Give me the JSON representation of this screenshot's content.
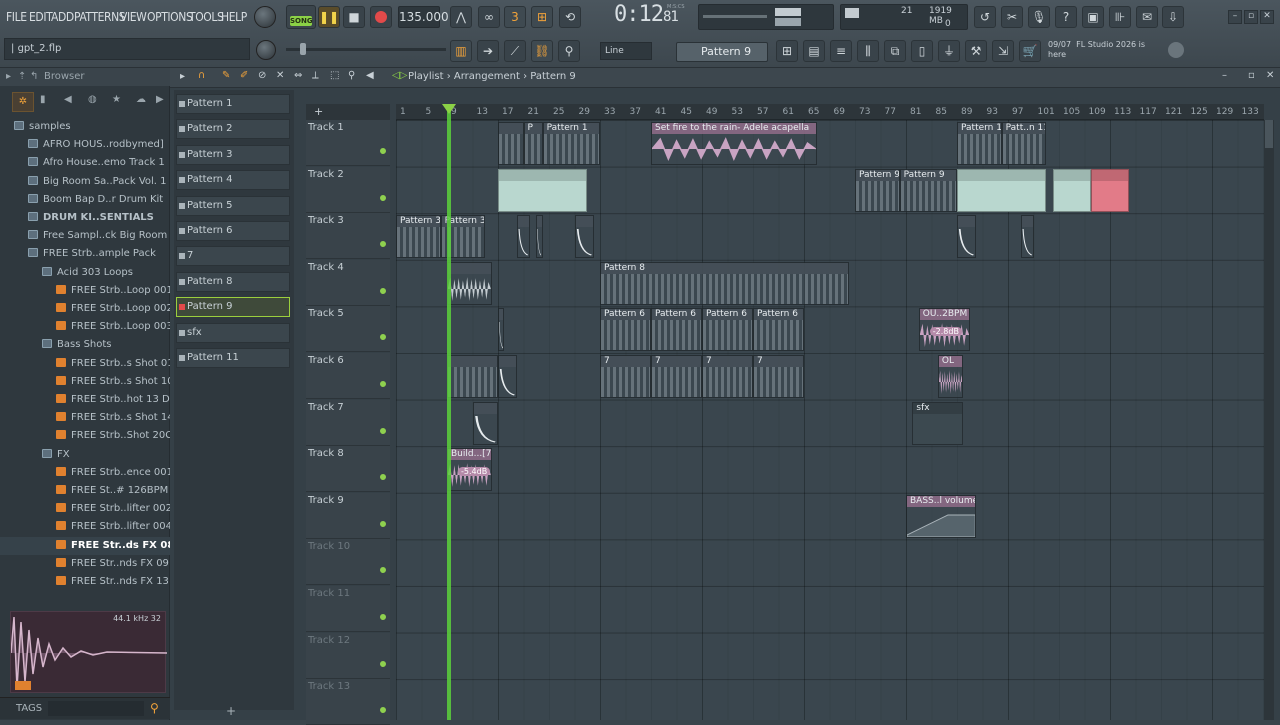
{
  "menu": [
    "FILE",
    "EDIT",
    "ADD",
    "PATTERNS",
    "VIEW",
    "OPTIONS",
    "TOOLS",
    "HELP"
  ],
  "transport": {
    "mode": "SONG",
    "tempo": "135.000",
    "time": "0:12",
    "time_frac": "81",
    "time_unit": "M:S:CS",
    "cpu_voices": "21",
    "memory": "1919 MB",
    "cpu_zero": "0"
  },
  "snap": "Line",
  "pattern_selector": "Pattern 9",
  "news": {
    "date": "09/07",
    "text": "FL Studio 2026 is here"
  },
  "project_file": "gpt_2.flp",
  "browser": {
    "title": "Browser",
    "items": [
      {
        "type": "folder",
        "indent": 0,
        "label": "samples"
      },
      {
        "type": "folder",
        "indent": 1,
        "label": "AFRO HOUS..rodbymed]"
      },
      {
        "type": "folder",
        "indent": 1,
        "label": "Afro House..emo Track 1"
      },
      {
        "type": "folder",
        "indent": 1,
        "label": "Big Room Sa..Pack Vol. 1"
      },
      {
        "type": "folder",
        "indent": 1,
        "label": "Boom Bap D..r Drum Kit"
      },
      {
        "type": "folder",
        "indent": 1,
        "label": "DRUM KI..SENTIALS"
      },
      {
        "type": "folder",
        "indent": 1,
        "label": "Free Sampl..ck Big Room"
      },
      {
        "type": "folder",
        "indent": 1,
        "label": "FREE Strb..ample Pack"
      },
      {
        "type": "folder",
        "indent": 2,
        "label": "Acid 303 Loops"
      },
      {
        "type": "file",
        "indent": 3,
        "label": "FREE Strb..Loop 001"
      },
      {
        "type": "file",
        "indent": 3,
        "label": "FREE Strb..Loop 002"
      },
      {
        "type": "file",
        "indent": 3,
        "label": "FREE Strb..Loop 003"
      },
      {
        "type": "folder",
        "indent": 2,
        "label": "Bass Shots"
      },
      {
        "type": "file",
        "indent": 3,
        "label": "FREE Strb..s Shot 01"
      },
      {
        "type": "file",
        "indent": 3,
        "label": "FREE Strb..s Shot 10"
      },
      {
        "type": "file",
        "indent": 3,
        "label": "FREE Strb..hot 13 D"
      },
      {
        "type": "file",
        "indent": 3,
        "label": "FREE Strb..s Shot 14"
      },
      {
        "type": "file",
        "indent": 3,
        "label": "FREE Strb..Shot 20C"
      },
      {
        "type": "folder",
        "indent": 2,
        "label": "FX"
      },
      {
        "type": "file",
        "indent": 3,
        "label": "FREE Strb..ence 001"
      },
      {
        "type": "file",
        "indent": 3,
        "label": "FREE St..# 126BPM"
      },
      {
        "type": "file",
        "indent": 3,
        "label": "FREE Strb..lifter 002"
      },
      {
        "type": "file",
        "indent": 3,
        "label": "FREE Strb..lifter 004"
      },
      {
        "type": "file",
        "indent": 3,
        "label": "FREE Str..ds FX 08",
        "selected": true
      },
      {
        "type": "file",
        "indent": 3,
        "label": "FREE Str..nds FX 09"
      },
      {
        "type": "file",
        "indent": 3,
        "label": "FREE Str..nds FX 13"
      }
    ],
    "sample_info": "44.1 kHz 32",
    "tags_label": "TAGS"
  },
  "playlist": {
    "breadcrumb": [
      "Playlist",
      "Arrangement",
      "Pattern 9"
    ],
    "patterns": [
      "Pattern 1",
      "Pattern 2",
      "Pattern 3",
      "Pattern 4",
      "Pattern 5",
      "Pattern 6",
      "7",
      "Pattern 8",
      "Pattern 9",
      "sfx",
      "Pattern 11"
    ],
    "selected_pattern": "Pattern 9",
    "tracks": [
      "Track 1",
      "Track 2",
      "Track 3",
      "Track 4",
      "Track 5",
      "Track 6",
      "Track 7",
      "Track 8",
      "Track 9",
      "Track 10",
      "Track 11",
      "Track 12",
      "Track 13"
    ],
    "ruler": [
      "1",
      "5",
      "9",
      "13",
      "17",
      "21",
      "25",
      "29",
      "33",
      "37",
      "41",
      "45",
      "49",
      "53",
      "57",
      "61",
      "65",
      "69",
      "73",
      "77",
      "81",
      "85",
      "89",
      "93",
      "97",
      "101",
      "105",
      "109",
      "113",
      "117",
      "121",
      "125",
      "129",
      "133"
    ],
    "clips": [
      {
        "track": 1,
        "start": 17,
        "len": 4,
        "label": "",
        "kind": "notes"
      },
      {
        "track": 1,
        "start": 21,
        "len": 3,
        "label": "P",
        "kind": "notes"
      },
      {
        "track": 1,
        "start": 24,
        "len": 9,
        "label": "Pattern 1",
        "kind": "notes"
      },
      {
        "track": 1,
        "start": 41,
        "len": 26,
        "label": "Set fire to the rain- Adele acapella",
        "kind": "audio",
        "color": "#c8a3c2"
      },
      {
        "track": 1,
        "start": 89,
        "len": 7,
        "label": "Pattern 11",
        "kind": "notes"
      },
      {
        "track": 1,
        "start": 96,
        "len": 7,
        "label": "Patt..n 11",
        "kind": "notes"
      },
      {
        "track": 2,
        "start": 17,
        "len": 14,
        "label": "",
        "kind": "pattern",
        "color": "#b9d7cf"
      },
      {
        "track": 2,
        "start": 73,
        "len": 7,
        "label": "Pattern 9",
        "kind": "notes"
      },
      {
        "track": 2,
        "start": 80,
        "len": 9,
        "label": "Pattern 9",
        "kind": "notes"
      },
      {
        "track": 2,
        "start": 89,
        "len": 14,
        "label": "",
        "kind": "pattern",
        "color": "#b9d7cf"
      },
      {
        "track": 2,
        "start": 104,
        "len": 6,
        "label": "",
        "kind": "pattern",
        "color": "#b9d7cf"
      },
      {
        "track": 2,
        "start": 110,
        "len": 6,
        "label": "",
        "kind": "pattern",
        "color": "#e27b88"
      },
      {
        "track": 3,
        "start": 1,
        "len": 7,
        "label": "Pattern 3",
        "kind": "notes"
      },
      {
        "track": 3,
        "start": 8,
        "len": 7,
        "label": "Pattern 3",
        "kind": "notes"
      },
      {
        "track": 3,
        "start": 20,
        "len": 2,
        "label": "",
        "kind": "shot"
      },
      {
        "track": 3,
        "start": 23,
        "len": 1,
        "label": "",
        "kind": "shot"
      },
      {
        "track": 3,
        "start": 29,
        "len": 3,
        "label": "",
        "kind": "shot"
      },
      {
        "track": 3,
        "start": 89,
        "len": 3,
        "label": "",
        "kind": "shot"
      },
      {
        "track": 3,
        "start": 99,
        "len": 2,
        "label": "",
        "kind": "shot"
      },
      {
        "track": 4,
        "start": 9,
        "len": 7,
        "label": "",
        "kind": "audio",
        "color": "#c3cbd0"
      },
      {
        "track": 4,
        "start": 33,
        "len": 39,
        "label": "Pattern 8",
        "kind": "notes"
      },
      {
        "track": 5,
        "start": 17,
        "len": 1,
        "label": "",
        "kind": "shot"
      },
      {
        "track": 5,
        "start": 33,
        "len": 8,
        "label": "Pattern 6",
        "kind": "notes"
      },
      {
        "track": 5,
        "start": 41,
        "len": 8,
        "label": "Pattern 6",
        "kind": "notes"
      },
      {
        "track": 5,
        "start": 49,
        "len": 8,
        "label": "Pattern 6",
        "kind": "notes"
      },
      {
        "track": 5,
        "start": 57,
        "len": 8,
        "label": "Pattern 6",
        "kind": "notes"
      },
      {
        "track": 5,
        "start": 83,
        "len": 8,
        "label": "OU..2BPM",
        "kind": "audio",
        "color": "#c8a3c2",
        "badge": "-2.8dB"
      },
      {
        "track": 6,
        "start": 9,
        "len": 8,
        "label": "",
        "kind": "notes"
      },
      {
        "track": 6,
        "start": 17,
        "len": 3,
        "label": "",
        "kind": "shot"
      },
      {
        "track": 6,
        "start": 33,
        "len": 8,
        "label": "7",
        "kind": "notes"
      },
      {
        "track": 6,
        "start": 41,
        "len": 8,
        "label": "7",
        "kind": "notes"
      },
      {
        "track": 6,
        "start": 49,
        "len": 8,
        "label": "7",
        "kind": "notes"
      },
      {
        "track": 6,
        "start": 57,
        "len": 8,
        "label": "7",
        "kind": "notes"
      },
      {
        "track": 6,
        "start": 86,
        "len": 4,
        "label": "OL",
        "kind": "audio",
        "color": "#c8a3c2"
      },
      {
        "track": 7,
        "start": 13,
        "len": 4,
        "label": "",
        "kind": "shot"
      },
      {
        "track": 7,
        "start": 82,
        "len": 8,
        "label": "sfx",
        "kind": "pattern",
        "color": "#3c4950"
      },
      {
        "track": 8,
        "start": 9,
        "len": 7,
        "label": "Build...[7]",
        "kind": "audio",
        "color": "#c8a3c2",
        "badge": "-5.4dB"
      },
      {
        "track": 9,
        "start": 81,
        "len": 11,
        "label": "BASS..l volume",
        "kind": "automation",
        "color": "#c8a3c2"
      }
    ]
  },
  "colors": {
    "accent": "#f2a33a",
    "playhead": "#5cd13c",
    "selected": "#9bcf3d"
  }
}
